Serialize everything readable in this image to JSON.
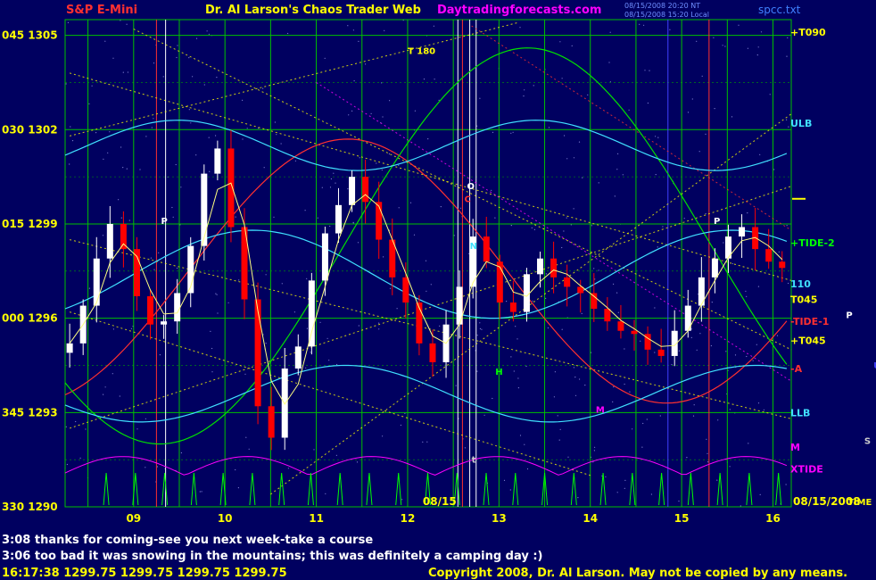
{
  "header": {
    "left_title": "S&P E-Mini",
    "center_title": "Dr. Al Larson's Chaos Trader Web",
    "site": "Daytradingforecasts.com",
    "date_stamp_1": "08/15/2008 20:20 NT",
    "date_stamp_2": "08/15/2008 15:20 Local",
    "file_name": "spcc.txt"
  },
  "messages": {
    "line_1": "3:08 thanks for coming-see you next week-take a course",
    "line_2": "3:06 too bad it was snowing in the mountains; this was definitely a camping day :)"
  },
  "footer": {
    "quote": "16:17:38  1299.75 1299.75 1299.75 1299.75",
    "copyright": "Copyright 2008, Dr. Al Larson. May not be copied by any means."
  },
  "colors": {
    "background": "#000060",
    "grid_green": "#00c000",
    "candle_up": "#ffffff",
    "candle_down": "#ff0000",
    "title_red": "#ff3030",
    "title_yellow": "#ffff00",
    "site_magenta": "#ff00ff"
  },
  "chart_data": {
    "type": "candlestick",
    "title": "S&P E-Mini",
    "y_labels": [
      {
        "value": 1305,
        "text": "045  1305"
      },
      {
        "value": 1302,
        "text": "030  1302"
      },
      {
        "value": 1299,
        "text": "015  1299"
      },
      {
        "value": 1296,
        "text": "000  1296"
      },
      {
        "value": 1293,
        "text": "345  1293"
      },
      {
        "value": 1290,
        "text": "330  1290"
      }
    ],
    "ylim": [
      1290,
      1305.5
    ],
    "xlim": [
      8.25,
      16.2
    ],
    "x_ticks": [
      {
        "x": 9,
        "text": "09"
      },
      {
        "x": 10,
        "text": "10"
      },
      {
        "x": 11,
        "text": "11"
      },
      {
        "x": 12,
        "text": "12"
      },
      {
        "x": 13,
        "text": "13"
      },
      {
        "x": 14,
        "text": "14"
      },
      {
        "x": 15,
        "text": "15"
      },
      {
        "x": 16,
        "text": "16"
      }
    ],
    "date_label": "08/15",
    "right_axis_date": "08/15/2008",
    "right_axis_time_label": "TIME",
    "closes": [
      1295.2,
      1296.4,
      1297.9,
      1299.0,
      1298.2,
      1296.7,
      1295.8,
      1295.9,
      1296.8,
      1298.3,
      1300.6,
      1301.4,
      1298.9,
      1296.6,
      1293.2,
      1292.2,
      1294.4,
      1295.1,
      1297.2,
      1298.7,
      1299.6,
      1300.5,
      1299.7,
      1298.5,
      1297.3,
      1296.5,
      1295.2,
      1294.6,
      1295.8,
      1297.0,
      1298.6,
      1297.8,
      1296.5,
      1296.2,
      1297.4,
      1297.9,
      1297.3,
      1297.0,
      1296.8,
      1296.3,
      1295.9,
      1295.6,
      1295.5,
      1295.0,
      1294.8,
      1295.6,
      1296.4,
      1297.3,
      1297.9,
      1298.6,
      1298.9,
      1298.2,
      1297.8,
      1297.6
    ],
    "price_labels": [
      {
        "text": "+T090",
        "value": 1305.1,
        "color": "#ffff00"
      },
      {
        "text": "ULB",
        "value": 1302.2,
        "color": "#40e0ff"
      },
      {
        "text": "+TIDE-2",
        "value": 1298.4,
        "color": "#00ff00"
      },
      {
        "text": "110",
        "value": 1297.1,
        "color": "#40e0ff"
      },
      {
        "text": "T045",
        "value": 1296.6,
        "color": "#ffff00"
      },
      {
        "text": "-TIDE-1",
        "value": 1295.9,
        "color": "#ff3030"
      },
      {
        "text": "+T045",
        "value": 1295.3,
        "color": "#ffff00"
      },
      {
        "text": "-A",
        "value": 1294.4,
        "color": "#ff3030"
      },
      {
        "text": "LLB",
        "value": 1293.0,
        "color": "#40e0ff"
      },
      {
        "text": "M",
        "value": 1291.9,
        "color": "#ff00ff"
      },
      {
        "text": "XTIDE",
        "value": 1291.2,
        "color": "#ff00ff"
      }
    ],
    "annotations": [
      {
        "text": "T 180",
        "x": 12.0,
        "y": 1304.4,
        "color": "#ffff00"
      },
      {
        "text": "O",
        "x": 12.65,
        "y": 1300.1,
        "color": "#ffffff"
      },
      {
        "text": "C",
        "x": 12.62,
        "y": 1299.7,
        "color": "#ff3030"
      },
      {
        "text": "P",
        "x": 9.3,
        "y": 1299.0,
        "color": "#ffffff"
      },
      {
        "text": "P",
        "x": 15.35,
        "y": 1299.0,
        "color": "#ffffff"
      },
      {
        "text": "N",
        "x": 12.68,
        "y": 1298.2,
        "color": "#40e0ff"
      },
      {
        "text": "H",
        "x": 12.96,
        "y": 1294.2,
        "color": "#00ff00"
      },
      {
        "text": "M",
        "x": 14.06,
        "y": 1293.0,
        "color": "#ff00ff"
      },
      {
        "text": "t",
        "x": 12.7,
        "y": 1291.4,
        "color": "#cccccc"
      },
      {
        "text": "P",
        "x": 16.8,
        "y": 1296.0,
        "color": "#ffffff"
      },
      {
        "text": "S",
        "x": 17.0,
        "y": 1292.0,
        "color": "#cccccc"
      },
      {
        "text": "U",
        "x": 17.1,
        "y": 1294.4,
        "color": "#4040ff"
      }
    ]
  }
}
